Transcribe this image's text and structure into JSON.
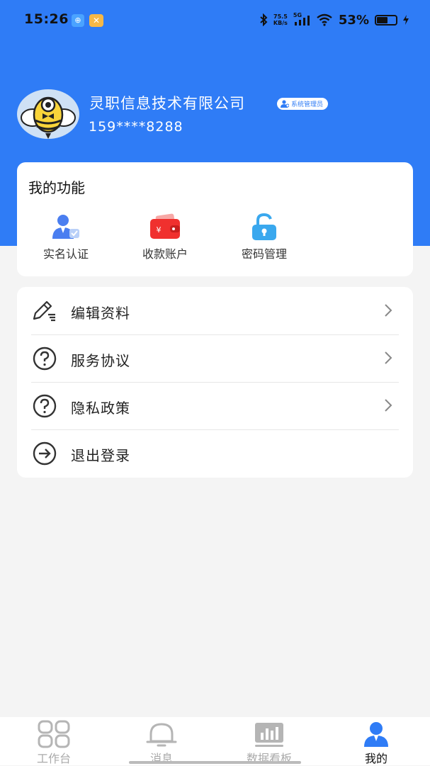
{
  "status_bar": {
    "time": "15:26",
    "speed_value": "75.5",
    "speed_unit": "KB/s",
    "network": "5G",
    "battery_pct": "53%",
    "battery_level": 0.53
  },
  "profile": {
    "company": "灵职信息技术有限公司",
    "role_badge": "系统管理员",
    "phone": "159****8288"
  },
  "functions": {
    "title": "我的功能",
    "items": [
      {
        "label": "实名认证",
        "icon": "user-verify-icon"
      },
      {
        "label": "收款账户",
        "icon": "wallet-icon"
      },
      {
        "label": "密码管理",
        "icon": "lock-icon"
      }
    ]
  },
  "menu": {
    "items": [
      {
        "label": "编辑资料",
        "icon": "edit-icon",
        "chevron": true
      },
      {
        "label": "服务协议",
        "icon": "question-icon",
        "chevron": true
      },
      {
        "label": "隐私政策",
        "icon": "question-icon",
        "chevron": true
      },
      {
        "label": "退出登录",
        "icon": "logout-icon",
        "chevron": false
      }
    ]
  },
  "tabbar": {
    "items": [
      {
        "label": "工作台",
        "icon": "grid-icon"
      },
      {
        "label": "消息",
        "icon": "bell-icon"
      },
      {
        "label": "数据看板",
        "icon": "chart-board-icon"
      },
      {
        "label": "我的",
        "icon": "person-icon"
      }
    ],
    "active": "我的"
  },
  "colors": {
    "brand_blue": "#2f7cf6",
    "background": "#f4f4f4",
    "wallet_red": "#f0302e",
    "lock_blue": "#3aa8ee"
  }
}
